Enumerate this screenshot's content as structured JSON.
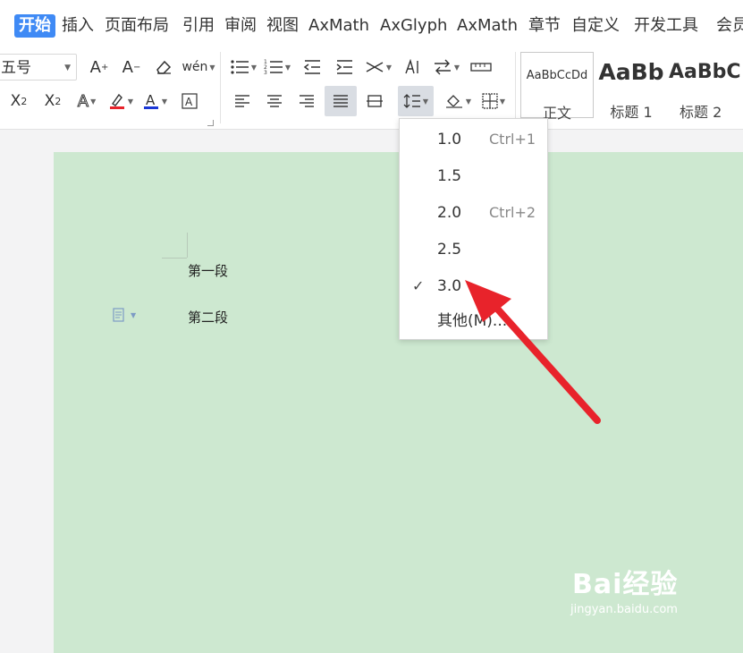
{
  "menu": {
    "tabs": [
      "开始",
      "插入",
      "页面布局",
      "引用",
      "审阅",
      "视图",
      "AxMath",
      "AxGlyph",
      "AxMath",
      "章节",
      "自定义",
      "开发工具",
      "会员"
    ]
  },
  "ribbon": {
    "font_size_value": "五号",
    "styles": [
      {
        "sample": "AaBbCcDd",
        "name": "正文"
      },
      {
        "sample": "AaBb",
        "name": "标题 1"
      },
      {
        "sample": "AaBbC",
        "name": "标题 2"
      }
    ]
  },
  "document": {
    "paragraphs": [
      "第一段",
      "第二段"
    ]
  },
  "line_spacing_menu": {
    "items": [
      {
        "label": "1.0",
        "shortcut": "Ctrl+1",
        "checked": false
      },
      {
        "label": "1.5",
        "shortcut": "",
        "checked": false
      },
      {
        "label": "2.0",
        "shortcut": "Ctrl+2",
        "checked": false
      },
      {
        "label": "2.5",
        "shortcut": "",
        "checked": false
      },
      {
        "label": "3.0",
        "shortcut": "",
        "checked": true
      },
      {
        "label": "其他(M)...",
        "shortcut": "",
        "checked": false
      }
    ]
  },
  "watermark": {
    "brand": "Bai经验",
    "url": "jingyan.baidu.com"
  },
  "colors": {
    "accent": "#3f8af5",
    "page_background": "#cde8d0",
    "arrow": "#e8232b"
  }
}
